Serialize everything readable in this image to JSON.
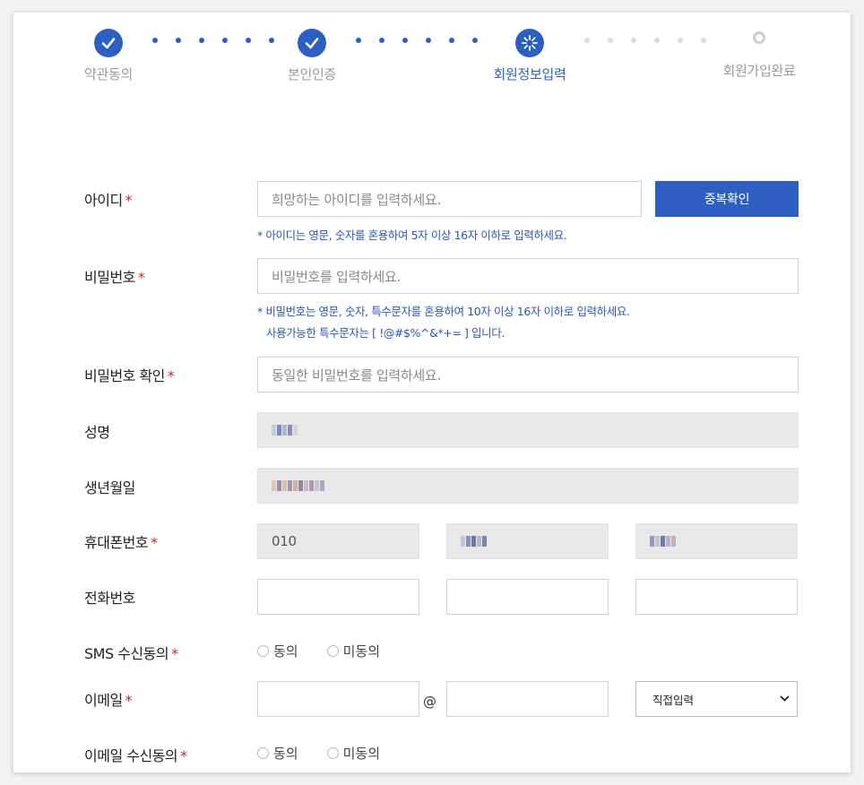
{
  "steps": [
    {
      "label": "약관동의",
      "state": "done"
    },
    {
      "label": "본인인증",
      "state": "done"
    },
    {
      "label": "회원정보입력",
      "state": "active"
    },
    {
      "label": "회원가입완료",
      "state": "pending"
    }
  ],
  "required_mark": "*",
  "form": {
    "userid": {
      "label": "아이디",
      "placeholder": "희망하는 아이디를 입력하세요.",
      "button": "중복확인",
      "hint": "* 아이디는 영문, 숫자를 혼용하여 5자 이상 16자 이하로 입력하세요."
    },
    "password": {
      "label": "비밀번호",
      "placeholder": "비밀번호를 입력하세요.",
      "hint_line1": "* 비밀번호는 영문, 숫자, 특수문자를 혼용하여 10자 이상 16자 이하로 입력하세요.",
      "hint_line2": "사용가능한 특수문자는 [ !@#$%^&*+= ] 입니다."
    },
    "password_confirm": {
      "label": "비밀번호 확인",
      "placeholder": "동일한 비밀번호를 입력하세요."
    },
    "name": {
      "label": "성명"
    },
    "birth": {
      "label": "생년월일"
    },
    "mobile": {
      "label": "휴대폰번호",
      "prefix": "010"
    },
    "phone": {
      "label": "전화번호"
    },
    "sms_consent": {
      "label": "SMS 수신동의",
      "agree": "동의",
      "disagree": "미동의"
    },
    "email": {
      "label": "이메일",
      "at": "@",
      "domain_select": "직접입력"
    },
    "email_consent": {
      "label": "이메일 수신동의",
      "agree": "동의",
      "disagree": "미동의"
    }
  },
  "colors": {
    "accent": "#2d5fc3",
    "required": "#d0242b",
    "hint": "#2d55b5"
  }
}
